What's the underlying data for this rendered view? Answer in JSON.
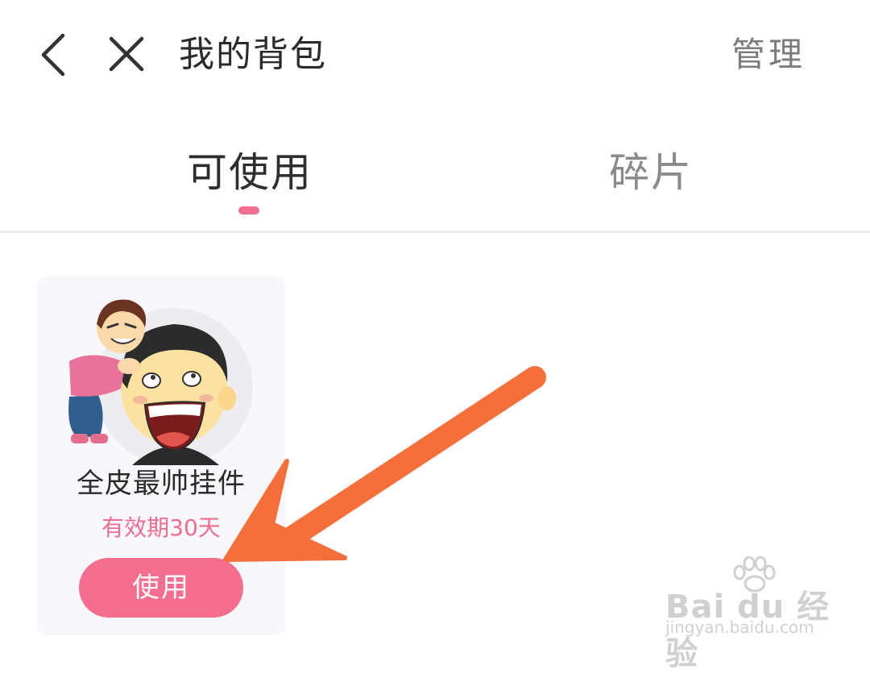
{
  "header": {
    "title": "我的背包",
    "manage_label": "管理",
    "back_icon": "chevron-left-icon",
    "close_icon": "close-icon"
  },
  "tabs": [
    {
      "label": "可使用",
      "active": true
    },
    {
      "label": "碎片",
      "active": false
    }
  ],
  "items": [
    {
      "name": "全皮最帅挂件",
      "expiry": "有效期30天",
      "use_label": "使用",
      "art_icon": "cartoon-avatar-pendant"
    }
  ],
  "annotation": {
    "icon": "orange-arrow-icon",
    "color": "#f46f3a"
  },
  "watermark": {
    "text": "Bai du 经验",
    "url": "jingyan.baidu.com"
  },
  "colors": {
    "accent": "#f56e90",
    "expiry": "#ee6d8f",
    "card_bg": "#f8f7fb",
    "arrow": "#f46f3a"
  }
}
